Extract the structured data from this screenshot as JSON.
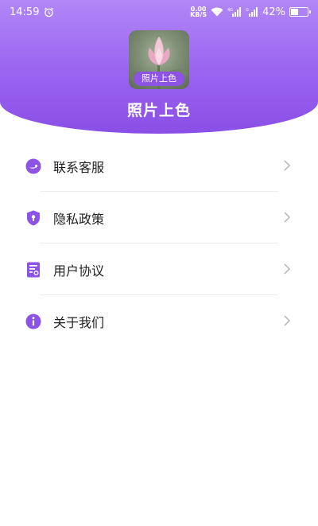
{
  "status_bar": {
    "time": "14:59",
    "net_speed_value": "0.00",
    "net_speed_unit": "KB/S",
    "battery_text": "42%",
    "battery_level": 0.42
  },
  "header": {
    "app_name": "照片上色",
    "avatar_badge": "照片上色"
  },
  "menu": {
    "items": [
      {
        "label": "联系客服",
        "icon": "customer-service-icon"
      },
      {
        "label": "隐私政策",
        "icon": "shield-icon"
      },
      {
        "label": "用户协议",
        "icon": "document-icon"
      },
      {
        "label": "关于我们",
        "icon": "info-icon"
      }
    ]
  },
  "colors": {
    "accent": "#8d52e6",
    "header_top": "#b187f7",
    "header_bottom": "#8a4fe6"
  }
}
